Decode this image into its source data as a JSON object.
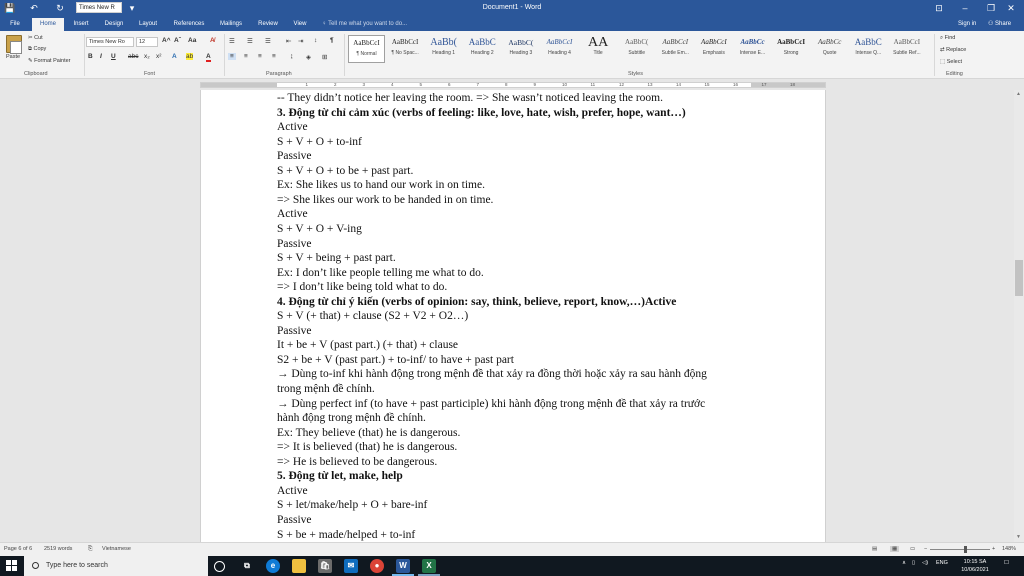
{
  "titlebar": {
    "font_box": "Times New R",
    "doc_title": "Document1 - Word",
    "save_glyph": "💾",
    "undo_glyph": "↶",
    "redo_glyph": "↻",
    "customize_glyph": "▾",
    "ribbon_display_glyph": "⊡",
    "minimize_glyph": "–",
    "maximize_glyph": "❐",
    "close_glyph": "✕"
  },
  "tabs": [
    {
      "label": "File"
    },
    {
      "label": "Home"
    },
    {
      "label": "Insert"
    },
    {
      "label": "Design"
    },
    {
      "label": "Layout"
    },
    {
      "label": "References"
    },
    {
      "label": "Mailings"
    },
    {
      "label": "Review"
    },
    {
      "label": "View"
    }
  ],
  "tell_me": "Tell me what you want to do...",
  "sign_in": "Sign in",
  "share": "Share",
  "ribbon": {
    "clipboard": {
      "paste": "Paste",
      "cut": "Cut",
      "copy": "Copy",
      "format_painter": "Format Painter",
      "label": "Clipboard"
    },
    "font": {
      "name": "Times New Ro",
      "size": "12",
      "label": "Font",
      "bold": "B",
      "italic": "I",
      "underline": "U",
      "strike": "abc",
      "sub": "x₂",
      "sup": "x²",
      "grow": "A^",
      "shrink": "Aˇ",
      "case": "Aa",
      "clear": "A̸",
      "effects": "A",
      "highlight": "ab",
      "color": "A"
    },
    "paragraph": {
      "label": "Paragraph",
      "show_marks": "¶"
    },
    "styles": {
      "label": "Styles",
      "items": [
        {
          "sample": "AaBbCcI",
          "name": "¶ Normal"
        },
        {
          "sample": "AaBbCcI",
          "name": "¶ No Spac..."
        },
        {
          "sample": "AaBb(",
          "name": "Heading 1"
        },
        {
          "sample": "AaBbC",
          "name": "Heading 2"
        },
        {
          "sample": "AaBbC(",
          "name": "Heading 3"
        },
        {
          "sample": "AaBbCcI",
          "name": "Heading 4"
        },
        {
          "sample": "AA",
          "name": "Title"
        },
        {
          "sample": "AaBbC(",
          "name": "Subtitle"
        },
        {
          "sample": "AaBbCcI",
          "name": "Subtle Em..."
        },
        {
          "sample": "AaBbCcI",
          "name": "Emphasis"
        },
        {
          "sample": "AaBbCc",
          "name": "Intense E..."
        },
        {
          "sample": "AaBbCcI",
          "name": "Strong"
        },
        {
          "sample": "AaBbCc",
          "name": "Quote"
        },
        {
          "sample": "AaBbC",
          "name": "Intense Q..."
        },
        {
          "sample": "AaBbCcI",
          "name": "Subtle Ref..."
        }
      ]
    },
    "editing": {
      "find": "Find",
      "replace": "Replace",
      "select": "Select",
      "label": "Editing"
    }
  },
  "ruler_numbers": [
    "1",
    "2",
    "3",
    "4",
    "5",
    "6",
    "7",
    "8",
    "9",
    "10",
    "11",
    "12",
    "13",
    "14",
    "15",
    "16",
    "17",
    "18"
  ],
  "document": {
    "lines": [
      {
        "text": "-- They didn’t notice her leaving the room. => She wasn’t noticed leaving the room.",
        "bold": false
      },
      {
        "text": "3. Động từ chỉ cảm xúc (verbs of feeling: like, love, hate, wish, prefer, hope, want…)",
        "bold": true
      },
      {
        "text": "Active",
        "bold": false
      },
      {
        "text": "S + V + O + to-inf",
        "bold": false
      },
      {
        "text": "Passive",
        "bold": false
      },
      {
        "text": "S + V + O + to be + past part.",
        "bold": false
      },
      {
        "text": "Ex: She likes us to hand our work in on time.",
        "bold": false
      },
      {
        "text": "=> She likes our work to be handed in on time.",
        "bold": false
      },
      {
        "text": "Active",
        "bold": false
      },
      {
        "text": "S + V + O + V-ing",
        "bold": false
      },
      {
        "text": "Passive",
        "bold": false
      },
      {
        "text": "S + V + being + past part.",
        "bold": false
      },
      {
        "text": "Ex: I don’t like people telling me what to do.",
        "bold": false
      },
      {
        "text": "=> I don’t like being told what to do.",
        "bold": false
      },
      {
        "text": "4. Động từ chỉ ý kiến (verbs of opinion: say, think, believe, report, know,…)Active",
        "bold": true
      },
      {
        "text": "S + V (+ that) + clause (S2 + V2 + O2…)",
        "bold": false
      },
      {
        "text": "Passive",
        "bold": false
      },
      {
        "text": "It + be + V (past part.) (+ that) + clause",
        "bold": false
      },
      {
        "text": "S2 + be + V (past part.) + to-inf/ to have + past part",
        "bold": false
      },
      {
        "text": "→ Dùng to-inf khi hành động trong mệnh đề that xảy ra đồng thời hoặc xảy ra sau hành động",
        "bold": false
      },
      {
        "text": "trong mệnh đề chính.",
        "bold": false
      },
      {
        "text": "→ Dùng perfect inf (to have + past participle) khi hành động trong mệnh đề that xảy ra trước",
        "bold": false
      },
      {
        "text": "hành động trong mệnh đề chính.",
        "bold": false
      },
      {
        "text": "Ex: They believe (that) he is dangerous.",
        "bold": false
      },
      {
        "text": "=> It is believed (that) he is dangerous.",
        "bold": false
      },
      {
        "text": "=> He is believed to be dangerous.",
        "bold": false
      },
      {
        "text": "5. Động từ let, make, help",
        "bold": true
      },
      {
        "text": "Active",
        "bold": false
      },
      {
        "text": "S + let/make/help + O + bare-inf",
        "bold": false
      },
      {
        "text": "Passive",
        "bold": false
      },
      {
        "text": "S + be + made/helped + to-inf",
        "bold": false
      }
    ]
  },
  "status": {
    "page": "Page 6 of 6",
    "words": "2519 words",
    "language": "Vietnamese",
    "zoom": "148%"
  },
  "taskbar": {
    "search_placeholder": "Type here to search",
    "lang": "ENG",
    "time": "10:15 SA",
    "date": "10/06/2021"
  },
  "colors": {
    "word_blue": "#2b579a",
    "taskbar": "#101820"
  }
}
